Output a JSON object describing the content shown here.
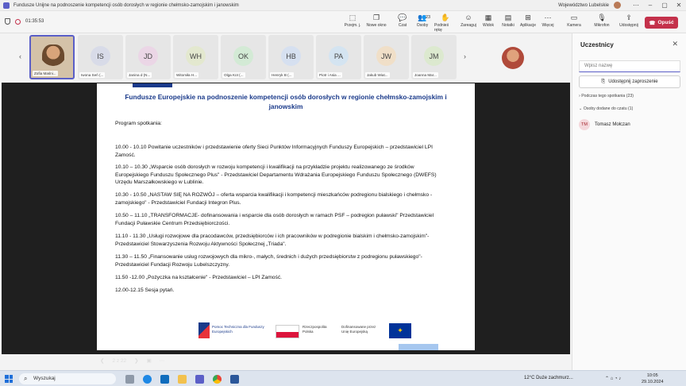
{
  "window": {
    "title": "Fundusze Unijne na podnoszenie kompetencji osób dorosłych w regionie chełmsko-zamojskim i janowskim",
    "org": "Województwo Lubelskie"
  },
  "toolbar": {
    "timer": "01:35:53",
    "buttons": [
      {
        "label": "Przejm. j.",
        "icon": "cursor-icon"
      },
      {
        "label": "Nowe okno",
        "icon": "window-icon"
      },
      {
        "label": "Czat",
        "icon": "chat-icon"
      },
      {
        "label": "Osoby",
        "icon": "people-icon",
        "badge": "23"
      },
      {
        "label": "Podnieś rękę",
        "icon": "hand-icon"
      },
      {
        "label": "Zareaguj",
        "icon": "emoji-icon"
      },
      {
        "label": "Widok",
        "icon": "view-icon"
      },
      {
        "label": "Notatki",
        "icon": "notes-icon"
      },
      {
        "label": "Aplikacje",
        "icon": "apps-icon"
      },
      {
        "label": "Więcej",
        "icon": "more-icon"
      },
      {
        "label": "Kamera",
        "icon": "camera-icon"
      },
      {
        "label": "Mikrofon",
        "icon": "mic-icon"
      },
      {
        "label": "Udostępnij",
        "icon": "share-icon"
      }
    ],
    "leave_label": "Opuść"
  },
  "participants": [
    {
      "initials": "",
      "name": "Zofia Maśni..."
    },
    {
      "initials": "IS",
      "name": "Iwona Seń (..."
    },
    {
      "initials": "JD",
      "name": "Janina d (N..."
    },
    {
      "initials": "WH",
      "name": "Witomiła H..."
    },
    {
      "initials": "OK",
      "name": "Olga Kot (..."
    },
    {
      "initials": "HB",
      "name": "Henryk B (..."
    },
    {
      "initials": "PA",
      "name": "Piotr i Asia ..."
    },
    {
      "initials": "JW",
      "name": "Jakub Wiat..."
    },
    {
      "initials": "JM",
      "name": "Joanna Mar..."
    }
  ],
  "slide": {
    "title": "Fundusze Europejskie na podnoszenie kompetencji osób dorosłych w regionie chełmsko-zamojskim i janowskim",
    "agenda_label": "Program spotkania:",
    "items": [
      "10.00 - 10.10  Powitanie uczestników i przedstawienie oferty Sieci Punktów Informacyjnych Funduszy Europejskich – przedstawiciel LPI Zamość.",
      "10.10 – 10.30  „Wsparcie osób dorosłych w rozwoju kompetencji i kwalifikacji na przykładzie projektu realizowanego ze środków Europejskiego Funduszu Społecznego Plus\" - Przedstawiciel Departamentu Wdrażania Europejskiego Funduszu Społecznego (DWEFS) Urzędu Marszałkowskiego w Lublinie.",
      "10.30 - 10.50 „NASTAW SIĘ NA ROZWÓJ – oferta wsparcia kwalifikacji i kompetencji mieszkańców podregionu bialskiego i chełmsko -zamojskiego\" - Przedstawiciel Fundacji Integron Plus.",
      "10.50 – 11.10 „TRANSFORMACJE- dofinansowania i wsparcie dla osób dorosłych w ramach PSF – podregion puławski\" Przedstawiciel Fundacji Puławskie Centrum Przedsiębiorczości.",
      "11.10 - 11.30 „Usługi rozwojowe dla pracodawców, przedsiębiorców i ich pracowników w podregionie bialskim i chełmsko-zamojskim\"- Przedstawiciel Stowarzyszenia Rozwoju Aktywności Społecznej „Triada\".",
      "11.30 – 11.50 „Finansowanie usług rozwojowych dla mikro-, małych, średnich i dużych przedsiębiorstw z podregionu puławskiego\"- Przedstawiciel Fundacji Rozwoju Lubelszczyzny.",
      "11.50 -12.00 „Pożyczka na kształcenie\" - Przedstawiciel – LPI Zamość.",
      "12.00-12.15 Sesja pytań."
    ],
    "logos": {
      "fe": "Pomoc Techniczna dla Funduszy Europejskich",
      "pl": "Rzeczpospolita Polska",
      "eu": "Dofinansowane przez Unię Europejską"
    }
  },
  "slide_controls": {
    "page": "2 z 22"
  },
  "panel": {
    "title": "Uczestnicy",
    "search_placeholder": "Wpisz nazwę",
    "share_label": "Udostępnij zaproszenie",
    "section_meeting": "Podczas tego spotkania (23)",
    "section_chat": "Osoby dodane do czatu (1)",
    "person": {
      "initials": "TM",
      "name": "Tomasz Mołczan"
    }
  },
  "taskbar": {
    "search_label": "Wyszukaj",
    "weather": "12°C  Duże zachmurz...",
    "time": "10:05",
    "date": "29.10.2024"
  }
}
